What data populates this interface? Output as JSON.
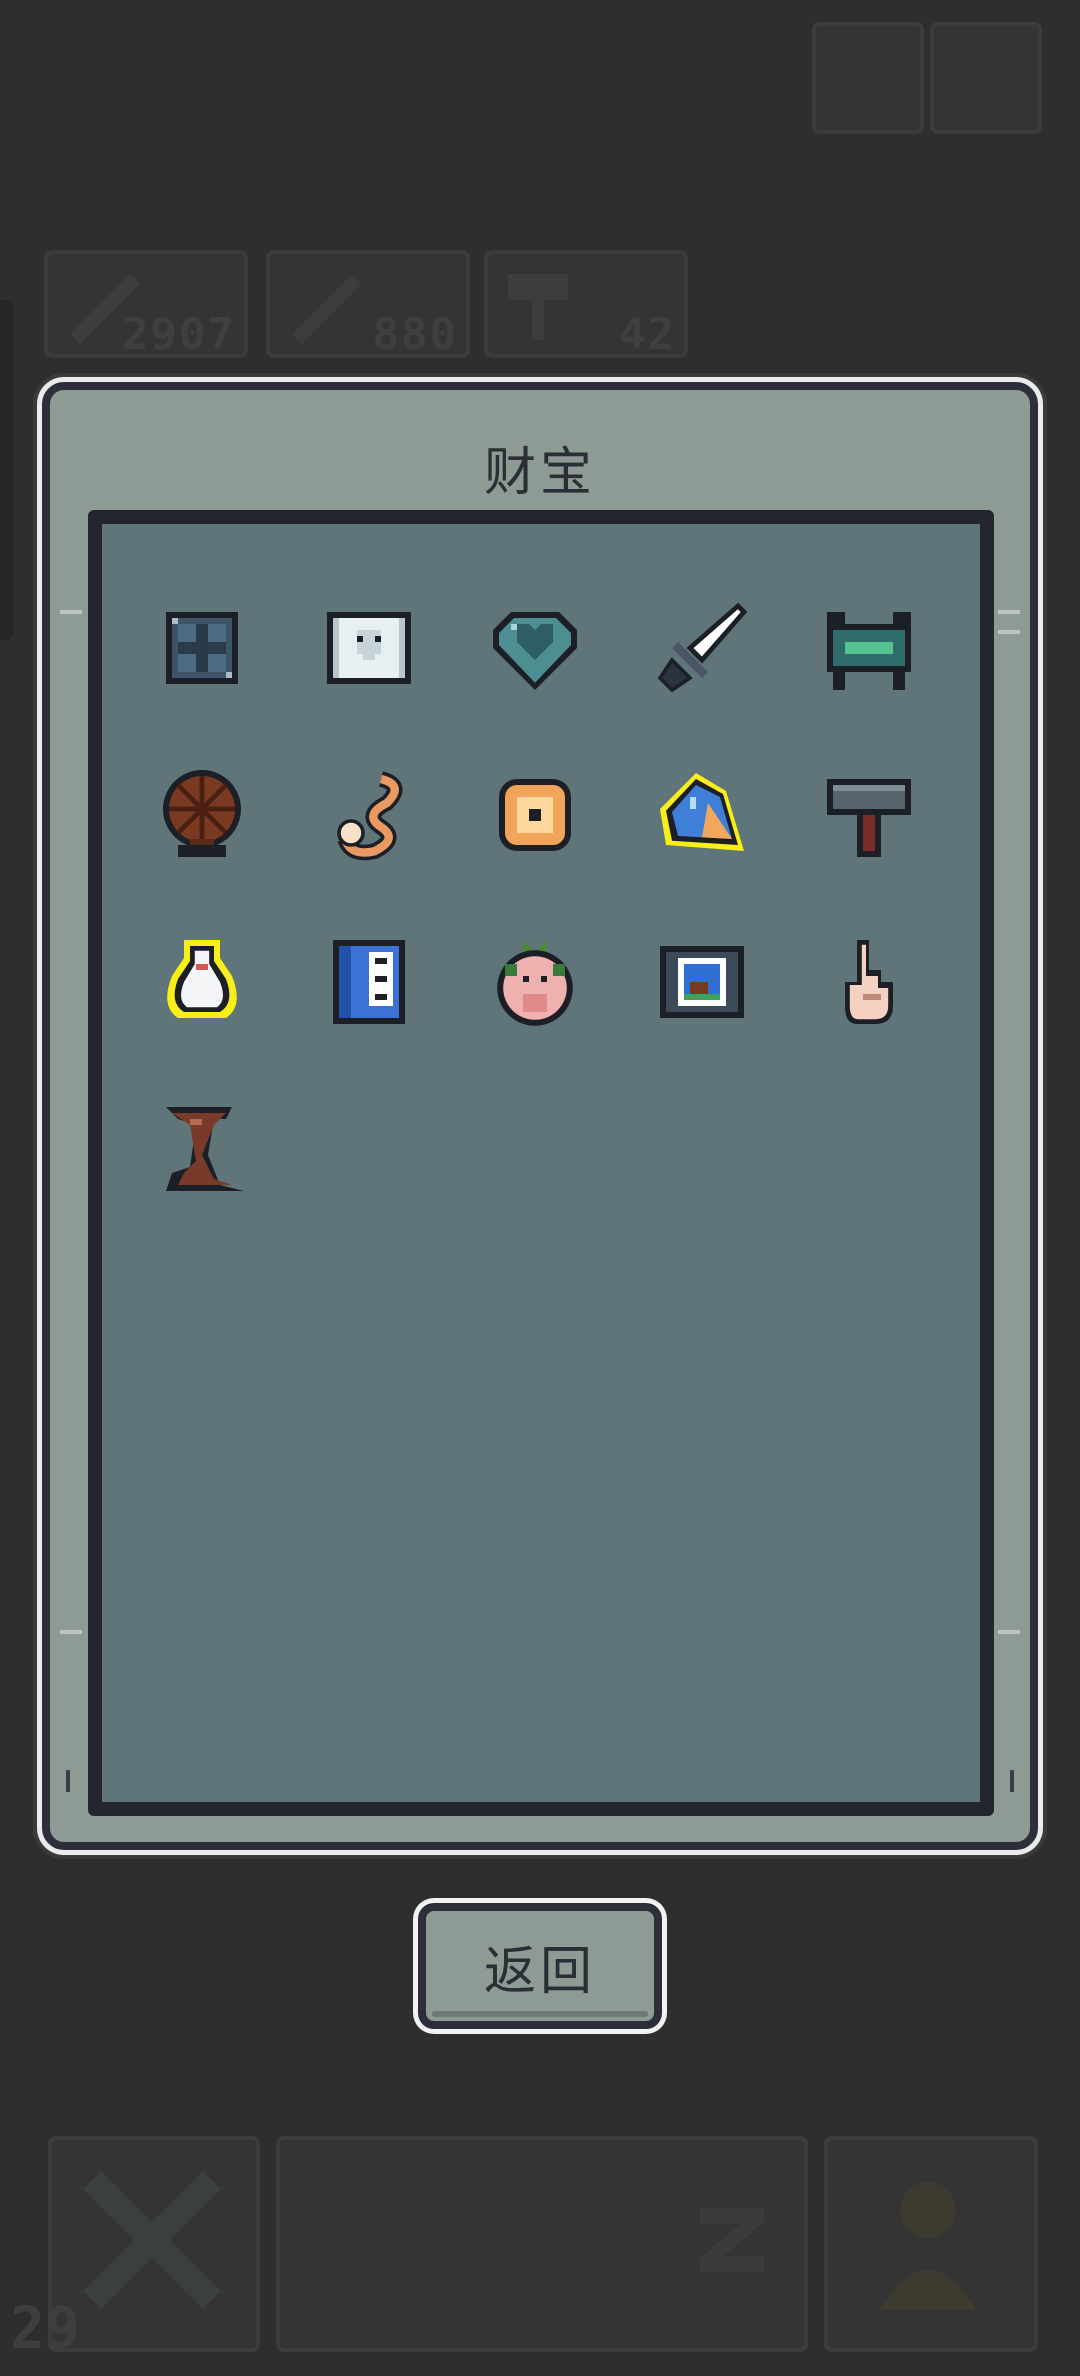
{
  "background": {
    "stats": [
      {
        "value": "2907",
        "icon": "sword-icon"
      },
      {
        "value": "880",
        "icon": "sword-icon"
      },
      {
        "value": "42",
        "icon": "hammer-icon"
      }
    ],
    "level": "29"
  },
  "dialog": {
    "title": "财宝",
    "treasures": [
      {
        "icon": "rune-tablet-icon"
      },
      {
        "icon": "skull-scroll-icon"
      },
      {
        "icon": "heart-gem-icon"
      },
      {
        "icon": "silver-dagger-icon"
      },
      {
        "icon": "jade-gate-icon"
      },
      {
        "icon": "spinning-wheel-icon"
      },
      {
        "icon": "coiled-snake-icon"
      },
      {
        "icon": "sun-biscuit-icon"
      },
      {
        "icon": "blue-crystal-icon"
      },
      {
        "icon": "iron-hammer-icon"
      },
      {
        "icon": "white-vase-icon"
      },
      {
        "icon": "blue-book-icon"
      },
      {
        "icon": "pig-head-icon"
      },
      {
        "icon": "framed-portrait-icon"
      },
      {
        "icon": "finger-gesture-icon"
      },
      {
        "icon": "stone-spike-icon"
      }
    ],
    "back_label": "返回"
  }
}
